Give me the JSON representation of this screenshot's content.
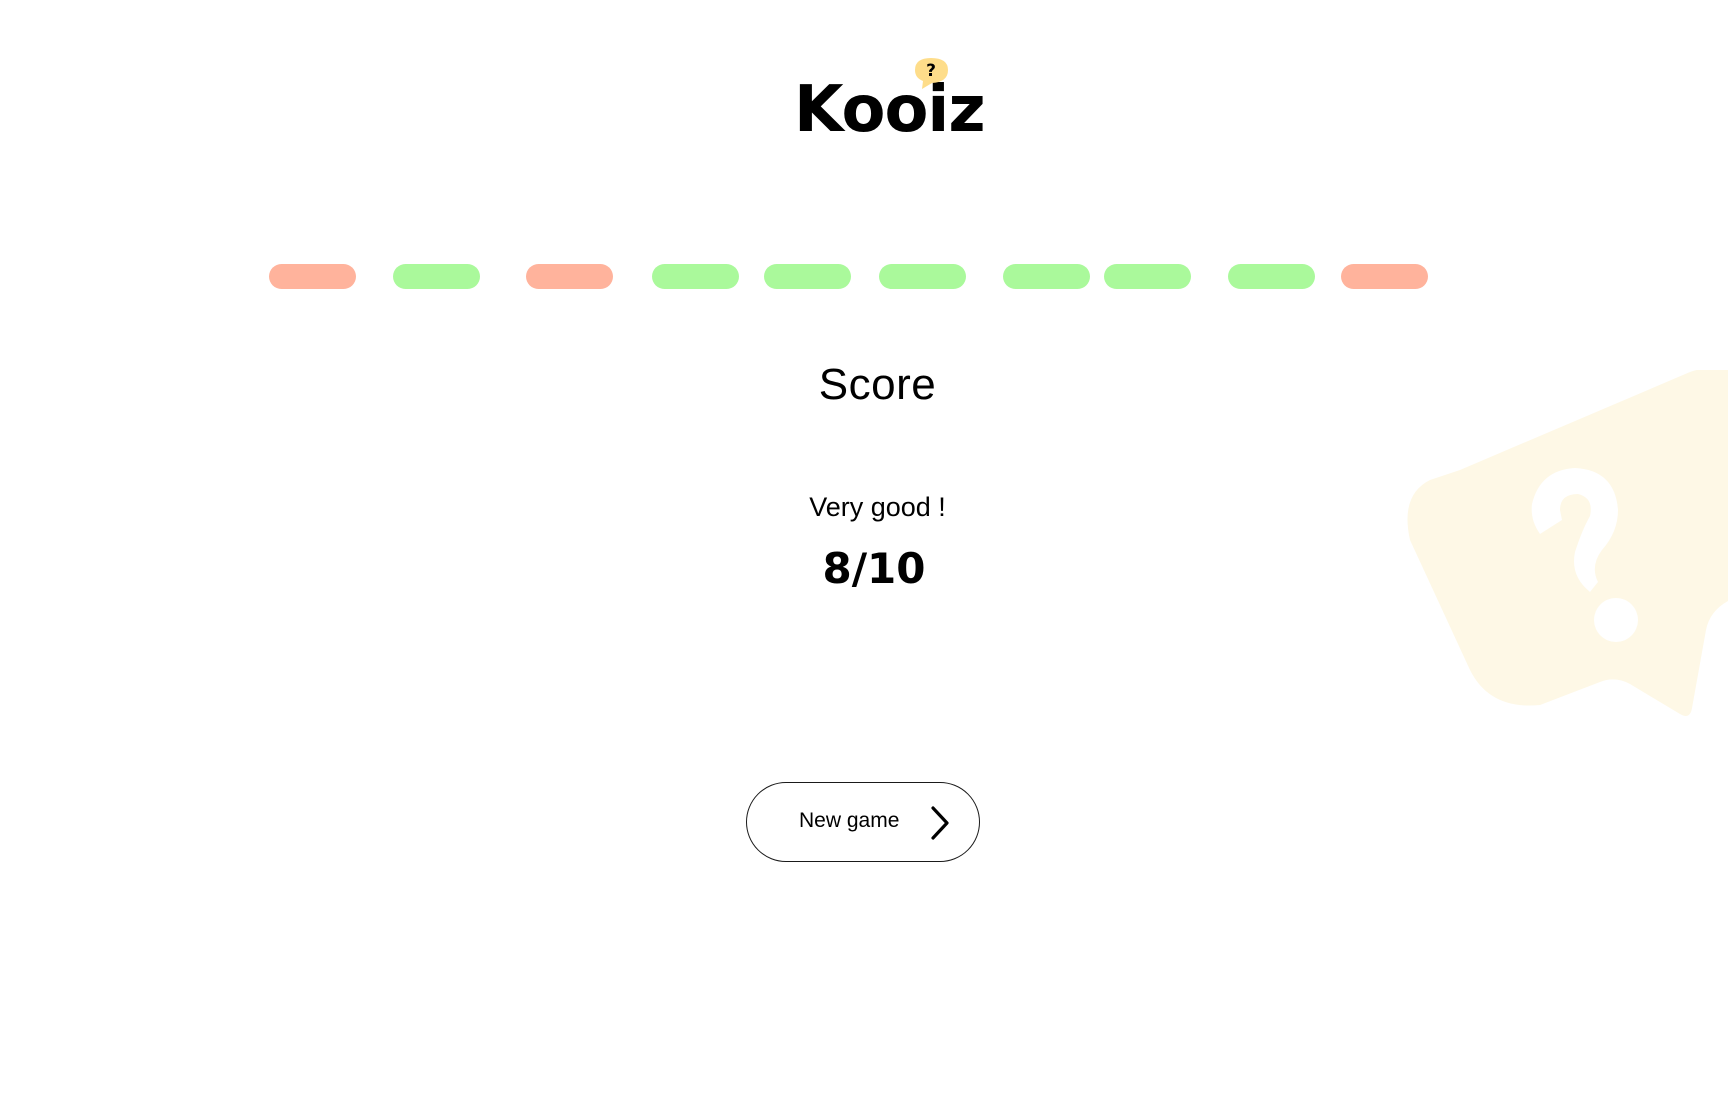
{
  "logo": {
    "text": "Kooiz",
    "bubble_icon": "question-bubble-icon",
    "bubble_glyph": "?"
  },
  "progress": {
    "results": [
      "wrong",
      "correct",
      "wrong",
      "correct",
      "correct",
      "correct",
      "correct",
      "correct",
      "correct",
      "wrong"
    ],
    "colors": {
      "correct": "#aaf99b",
      "wrong": "#ffb39c"
    }
  },
  "score": {
    "title": "Score",
    "message": "Very good !",
    "value": "8/10"
  },
  "actions": {
    "new_game_label": "New game",
    "new_game_icon": "chevron-right-icon"
  },
  "decoration": {
    "icon": "question-bubble-icon",
    "color": "#fef8e6"
  }
}
